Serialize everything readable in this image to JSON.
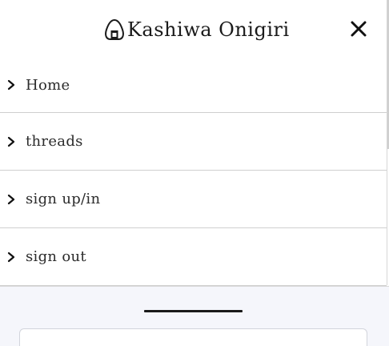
{
  "header": {
    "logo_icon": "onigiri-icon",
    "title": "Kashiwa Onigiri",
    "close_icon": "close-icon"
  },
  "menu": {
    "items": [
      {
        "label": "Home",
        "icon": "chevron-right-icon"
      },
      {
        "label": "threads",
        "icon": "chevron-right-icon"
      },
      {
        "label": "sign up/in",
        "icon": "chevron-right-icon"
      },
      {
        "label": "sign out",
        "icon": "chevron-right-icon"
      }
    ]
  },
  "colors": {
    "text": "#2b2b2b",
    "divider": "#cfcfcf",
    "lower_background": "#f5f6fb"
  }
}
